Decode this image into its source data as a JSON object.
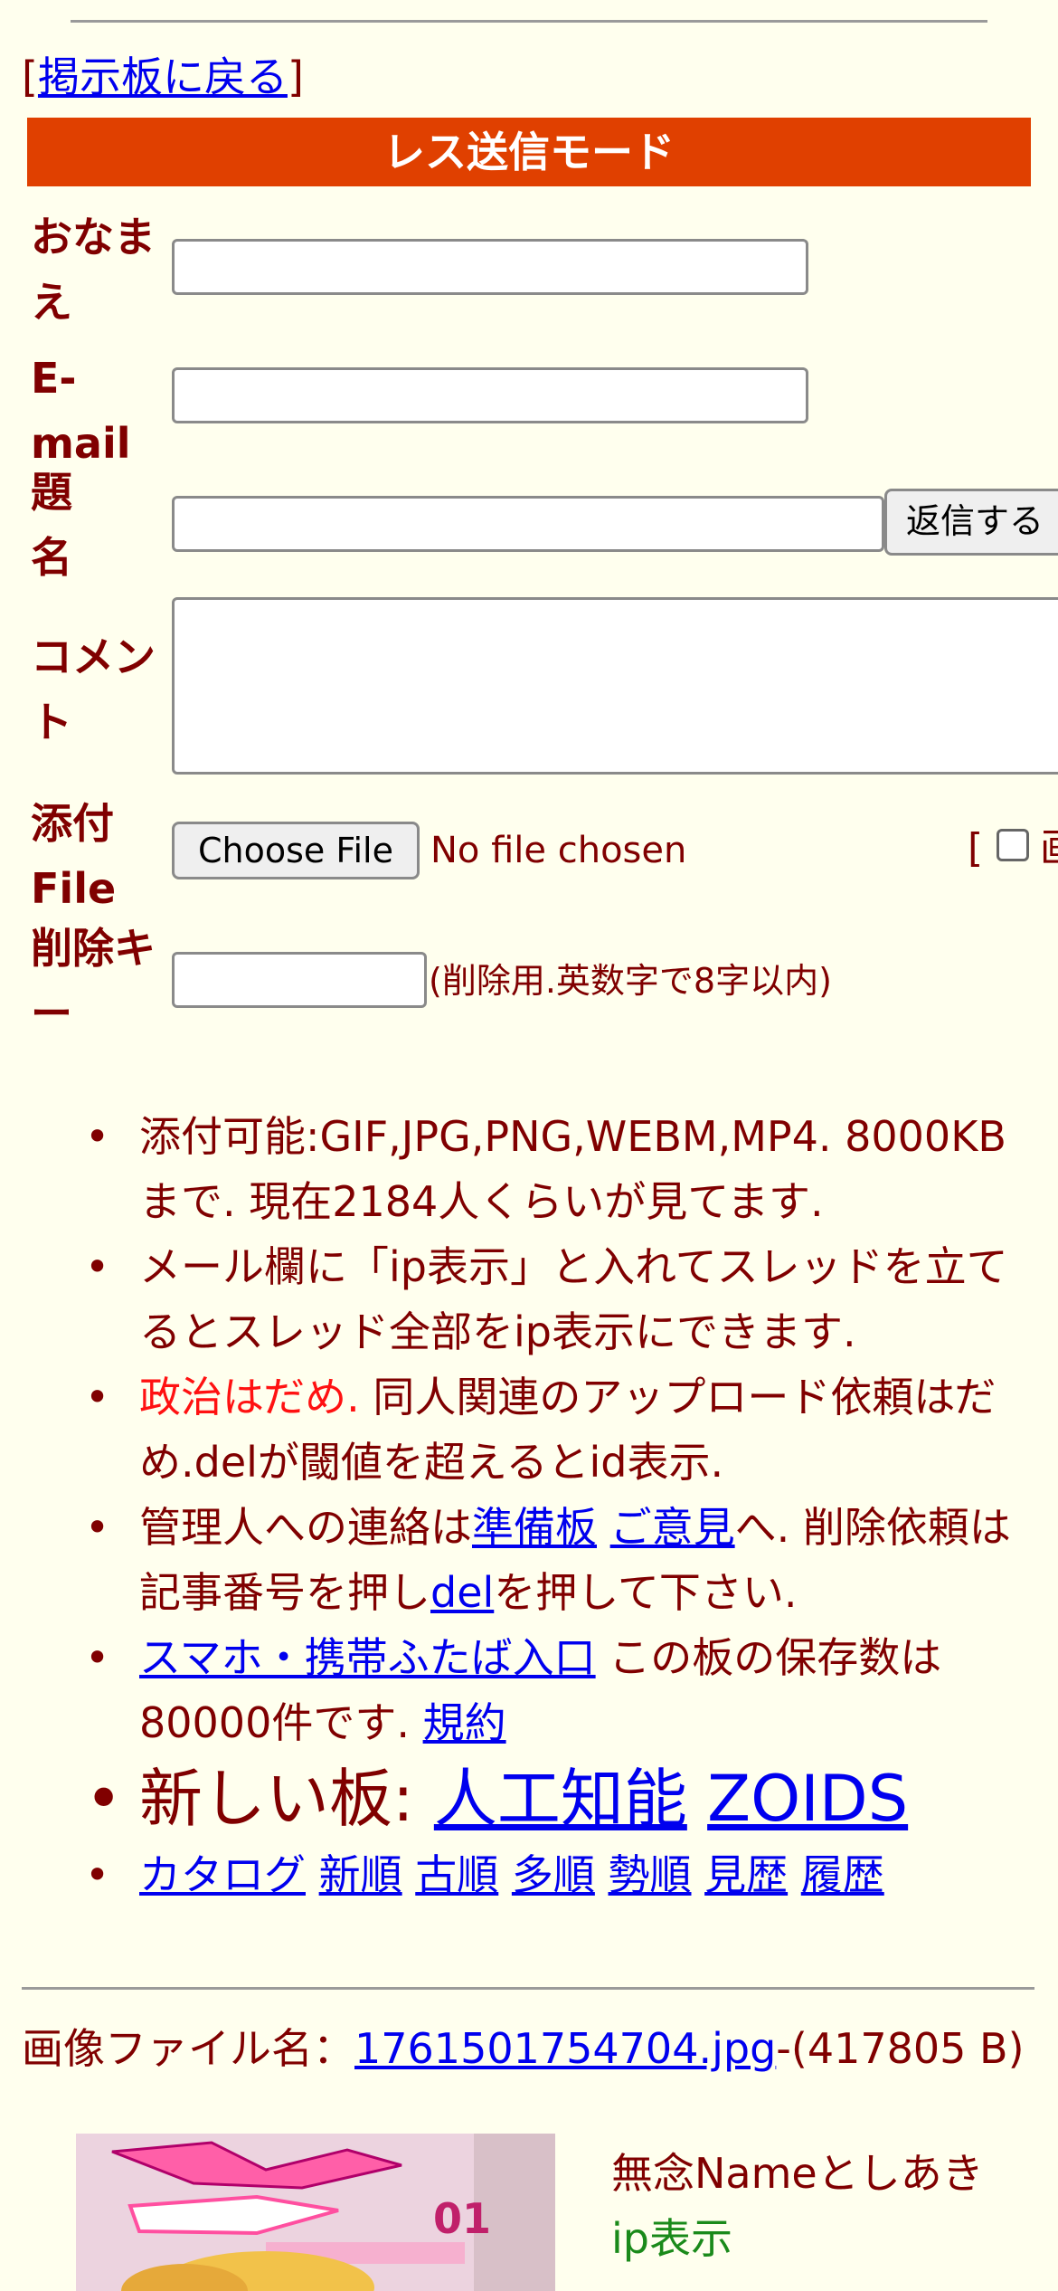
{
  "back": {
    "bracket_open": "[",
    "link": "掲示板に戻る",
    "bracket_close": "]"
  },
  "mode_title": "レス送信モード",
  "form": {
    "name_label": "おなまえ",
    "email_label": "E-mail",
    "subject_label": "題名",
    "submit_label": "返信する",
    "comment_label": "コメント",
    "file_label": "添付File",
    "choose_file_label": "Choose File",
    "no_file_text": "No file chosen",
    "image_toggle_bracket": "[",
    "delete_key_label": "削除キー",
    "delete_key_note": "(削除用.英数字で8字以内)"
  },
  "notes": {
    "n1": "添付可能:GIF,JPG,PNG,WEBM,MP4. 8000KBまで. 現在2184人くらいが見てます.",
    "n2": "メール欄に「ip表示」と入れてスレッドを立てるとスレッド全部をip表示にできます.",
    "n3_red": "政治はだめ.",
    "n3_rest": " 同人関連のアップロード依頼はだめ.delが閾値を超えるとid表示.",
    "n4_a": "管理人への連絡は",
    "n4_link1": "準備板",
    "n4_link2": "ご意見",
    "n4_b": "へ. 削除依頼は記事番号を押し",
    "n4_link3": "del",
    "n4_c": "を押して下さい.",
    "n5_link": "スマホ・携帯ふたば入口",
    "n5_text": " この板の保存数は80000件です. ",
    "n5_link2": "規約",
    "n6_text": "新しい板: ",
    "n6_link1": "人工知能",
    "n6_link2": "ZOIDS",
    "n7_links": [
      "カタログ",
      "新順",
      "古順",
      "多順",
      "勢順",
      "見歴",
      "履歴"
    ]
  },
  "post": {
    "file_label": "画像ファイル名：",
    "file_link": "1761501754704.jpg",
    "file_size": "-(417805 B)",
    "name": "無念Nameとしあき",
    "ip_label": "ip表示"
  }
}
